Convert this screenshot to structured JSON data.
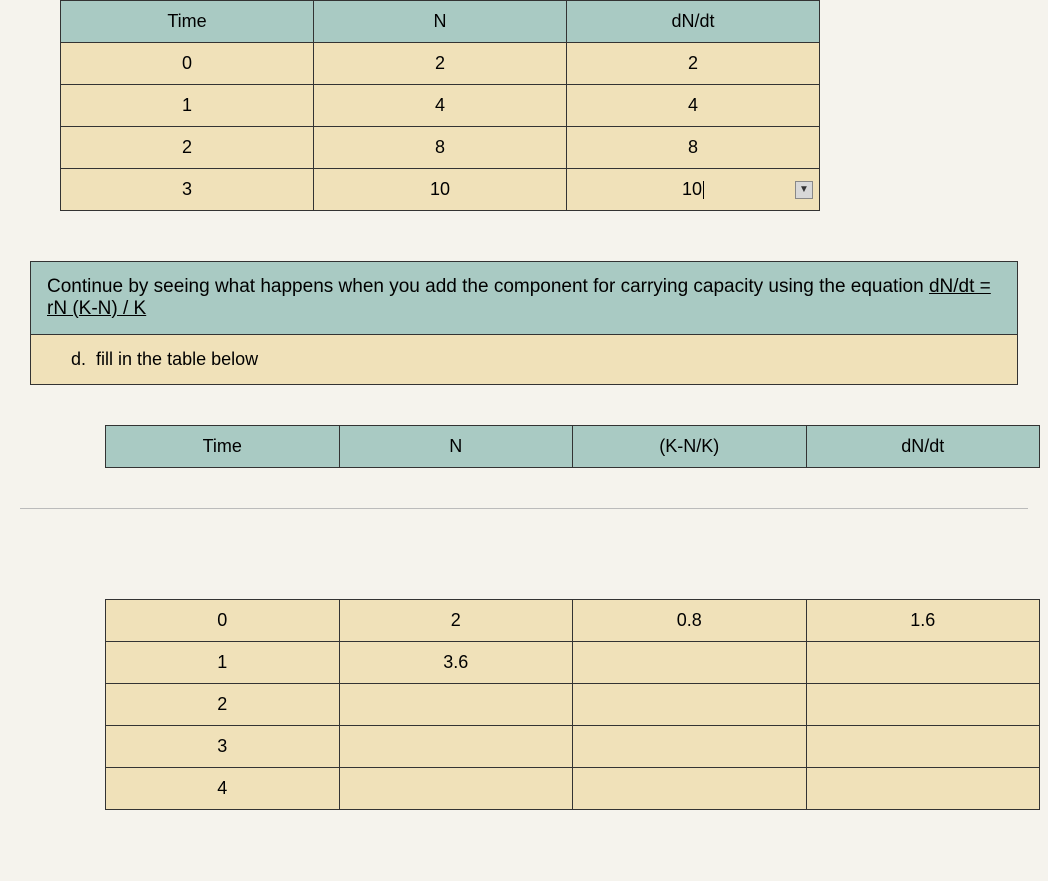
{
  "table1": {
    "headers": [
      "Time",
      "N",
      "dN/dt"
    ],
    "rows": [
      [
        "0",
        "2",
        "2"
      ],
      [
        "1",
        "4",
        "4"
      ],
      [
        "2",
        "8",
        "8"
      ],
      [
        "3",
        "10",
        "10"
      ]
    ]
  },
  "instruction": {
    "text_before": "Continue by seeing what happens when you add the component for carrying capacity using the equation ",
    "equation": "dN/dt = rN (K-N) / K",
    "sub_label": "d.",
    "sub_text": "fill in the table below"
  },
  "table2": {
    "headers": [
      "Time",
      "N",
      "(K-N/K)",
      "dN/dt"
    ],
    "rows": [
      [
        "0",
        "2",
        "0.8",
        "1.6"
      ],
      [
        "1",
        "3.6",
        "",
        ""
      ],
      [
        "2",
        "",
        "",
        ""
      ],
      [
        "3",
        "",
        "",
        ""
      ],
      [
        "4",
        "",
        "",
        ""
      ]
    ]
  }
}
